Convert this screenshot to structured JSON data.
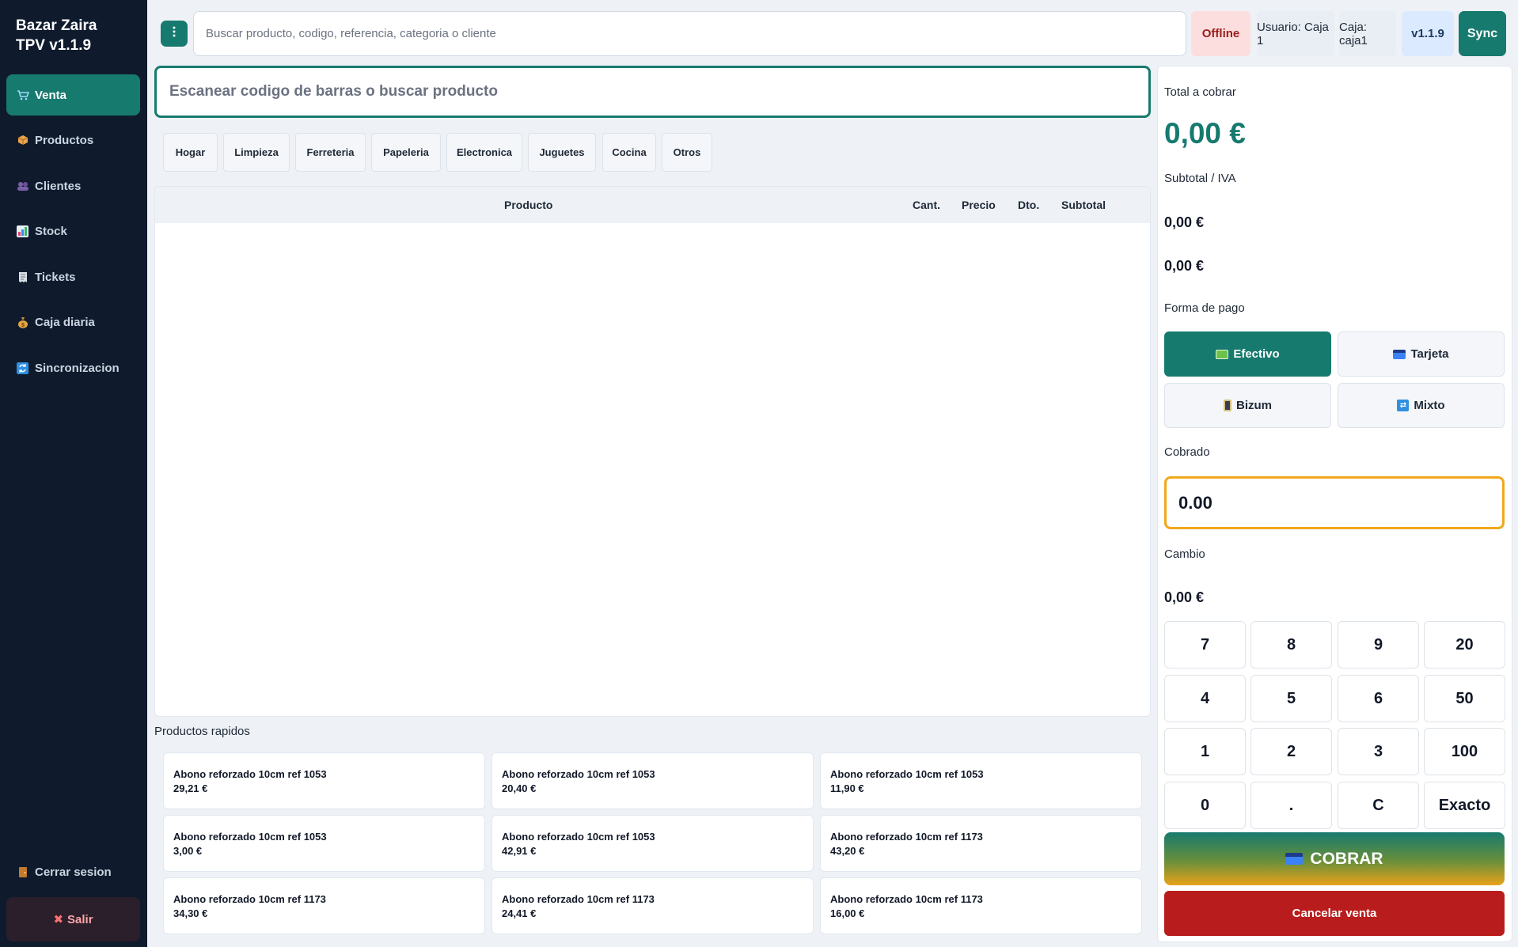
{
  "app": {
    "brand_line1": "Bazar Zaira",
    "brand_line2": "TPV v1.1.9",
    "accent_color": "#177a6e"
  },
  "sidebar": {
    "items": [
      {
        "label": "Venta",
        "icon": "cart-icon",
        "active": true
      },
      {
        "label": "Productos",
        "icon": "package-icon"
      },
      {
        "label": "Clientes",
        "icon": "users-icon"
      },
      {
        "label": "Stock",
        "icon": "chart-icon"
      },
      {
        "label": "Tickets",
        "icon": "receipt-icon"
      },
      {
        "label": "Caja diaria",
        "icon": "money-bag-icon"
      },
      {
        "label": "Sincronizacion",
        "icon": "sync-icon"
      }
    ],
    "logout_label": "Cerrar sesion",
    "exit_label": "Salir"
  },
  "topbar": {
    "search_placeholder": "Buscar producto, codigo, referencia, categoria o cliente",
    "status": "Offline",
    "user": "Usuario: Caja 1",
    "register": "Caja: caja1",
    "version": "v1.1.9",
    "sync_label": "Sync"
  },
  "scan": {
    "placeholder": "Escanear codigo de barras o buscar producto"
  },
  "categories": [
    "Hogar",
    "Limpieza",
    "Ferreteria",
    "Papeleria",
    "Electronica",
    "Juguetes",
    "Cocina",
    "Otros"
  ],
  "ticket": {
    "columns": [
      "Producto",
      "Cant.",
      "Precio",
      "Dto.",
      "Subtotal"
    ]
  },
  "quick": {
    "title": "Productos rapidos",
    "products": [
      {
        "name": "Abono reforzado 10cm ref 1053",
        "price": "29,21 €"
      },
      {
        "name": "Abono reforzado 10cm ref 1053",
        "price": "20,40 €"
      },
      {
        "name": "Abono reforzado 10cm ref 1053",
        "price": "11,90 €"
      },
      {
        "name": "Abono reforzado 10cm ref 1053",
        "price": "3,00 €"
      },
      {
        "name": "Abono reforzado 10cm ref 1053",
        "price": "42,91 €"
      },
      {
        "name": "Abono reforzado 10cm ref 1173",
        "price": "43,20 €"
      },
      {
        "name": "Abono reforzado 10cm ref 1173",
        "price": "34,30 €"
      },
      {
        "name": "Abono reforzado 10cm ref 1173",
        "price": "24,41 €"
      },
      {
        "name": "Abono reforzado 10cm ref 1173",
        "price": "16,00 €"
      }
    ]
  },
  "payment": {
    "total_label": "Total a cobrar",
    "total_value": "0,00 €",
    "subtotal_label": "Subtotal / IVA",
    "subtotal_value": "0,00 €",
    "iva_value": "0,00 €",
    "method_label": "Forma de pago",
    "methods": [
      {
        "label": "Efectivo",
        "icon": "cash-icon",
        "active": true
      },
      {
        "label": "Tarjeta",
        "icon": "card-icon"
      },
      {
        "label": "Bizum",
        "icon": "phone-icon"
      },
      {
        "label": "Mixto",
        "icon": "shuffle-icon"
      }
    ],
    "cobrado_label": "Cobrado",
    "cobrado_value": "0.00",
    "cambio_label": "Cambio",
    "cambio_value": "0,00 €",
    "keypad": [
      "7",
      "8",
      "9",
      "20",
      "4",
      "5",
      "6",
      "50",
      "1",
      "2",
      "3",
      "100",
      "0",
      ".",
      "C",
      "Exacto"
    ],
    "cobrar_label": "COBRAR",
    "cancel_label": "Cancelar venta",
    "cobrado_border_color": "#f0a81c",
    "cancel_color": "#b91c1c"
  }
}
